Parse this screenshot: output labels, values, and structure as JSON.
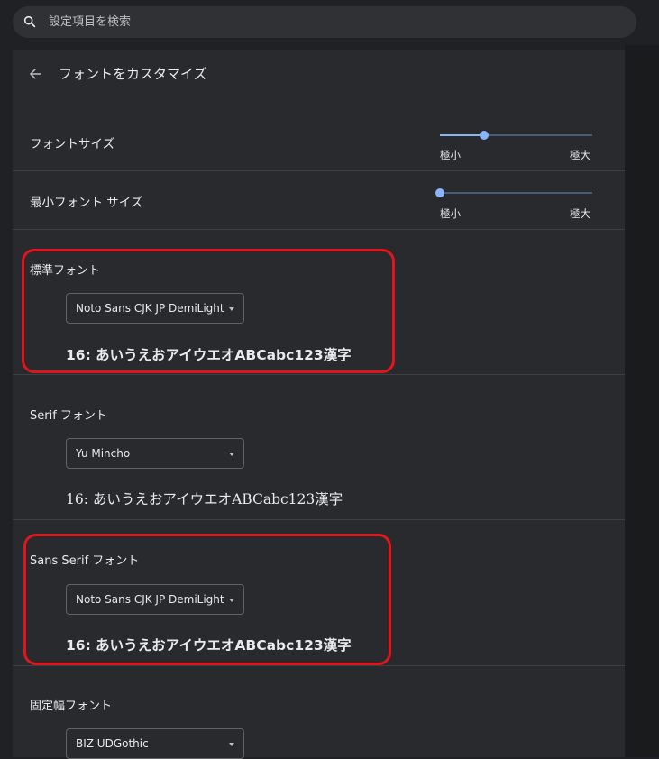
{
  "search": {
    "placeholder": "設定項目を検索"
  },
  "header": {
    "title": "フォントをカスタマイズ"
  },
  "font_size": {
    "label": "フォントサイズ",
    "min_label": "極小",
    "max_label": "極大",
    "value": 0.29
  },
  "min_font_size": {
    "label": "最小フォント サイズ",
    "min_label": "極小",
    "max_label": "極大",
    "value": 0.0
  },
  "standard_font": {
    "label": "標準フォント",
    "selected": "Noto Sans CJK JP DemiLight",
    "sample": "16: あいうえおアイウエオABCabc123漢字"
  },
  "serif_font": {
    "label": "Serif フォント",
    "selected": "Yu Mincho",
    "sample": "16: あいうえおアイウエオABCabc123漢字"
  },
  "sans_serif_font": {
    "label": "Sans Serif フォント",
    "selected": "Noto Sans CJK JP DemiLight",
    "sample": "16: あいうえおアイウエオABCabc123漢字"
  },
  "fixed_width_font": {
    "label": "固定幅フォント",
    "selected": "BIZ UDGothic"
  },
  "colors": {
    "background": "#202124",
    "panel": "#292a2d",
    "accent": "#8ab4f8",
    "highlight": "#e0161e"
  }
}
